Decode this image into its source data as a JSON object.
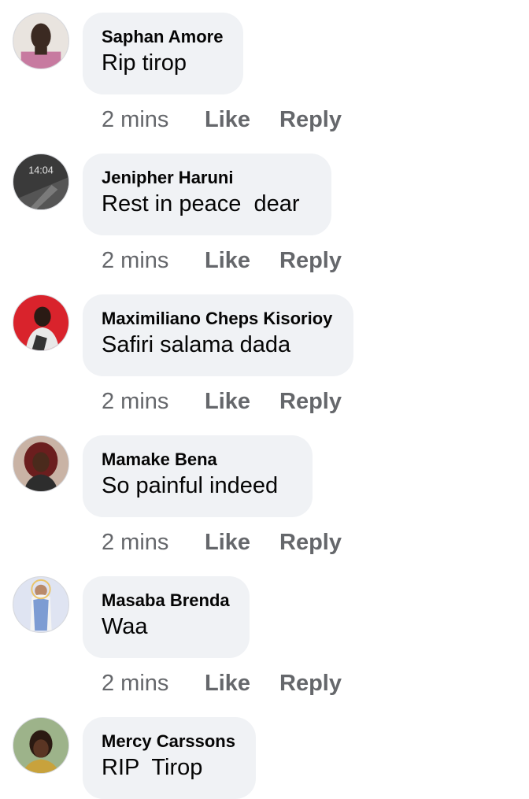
{
  "comments": [
    {
      "author": "Saphan Amore",
      "text": "Rip tirop",
      "time": "2 mins",
      "like_label": "Like",
      "reply_label": "Reply"
    },
    {
      "author": "Jenipher Haruni",
      "text": "Rest in peace  dear",
      "time": "2 mins",
      "like_label": "Like",
      "reply_label": "Reply",
      "avatar_text": "14:04"
    },
    {
      "author": "Maximiliano Cheps Kisorioy",
      "text": "Safiri salama dada",
      "time": "2 mins",
      "like_label": "Like",
      "reply_label": "Reply"
    },
    {
      "author": "Mamake Bena",
      "text": "So painful indeed",
      "time": "2 mins",
      "like_label": "Like",
      "reply_label": "Reply"
    },
    {
      "author": "Masaba Brenda",
      "text": "Waa",
      "time": "2 mins",
      "like_label": "Like",
      "reply_label": "Reply"
    },
    {
      "author": "Mercy Carssons",
      "text": "RIP  Tirop",
      "time": "",
      "like_label": "",
      "reply_label": ""
    }
  ]
}
